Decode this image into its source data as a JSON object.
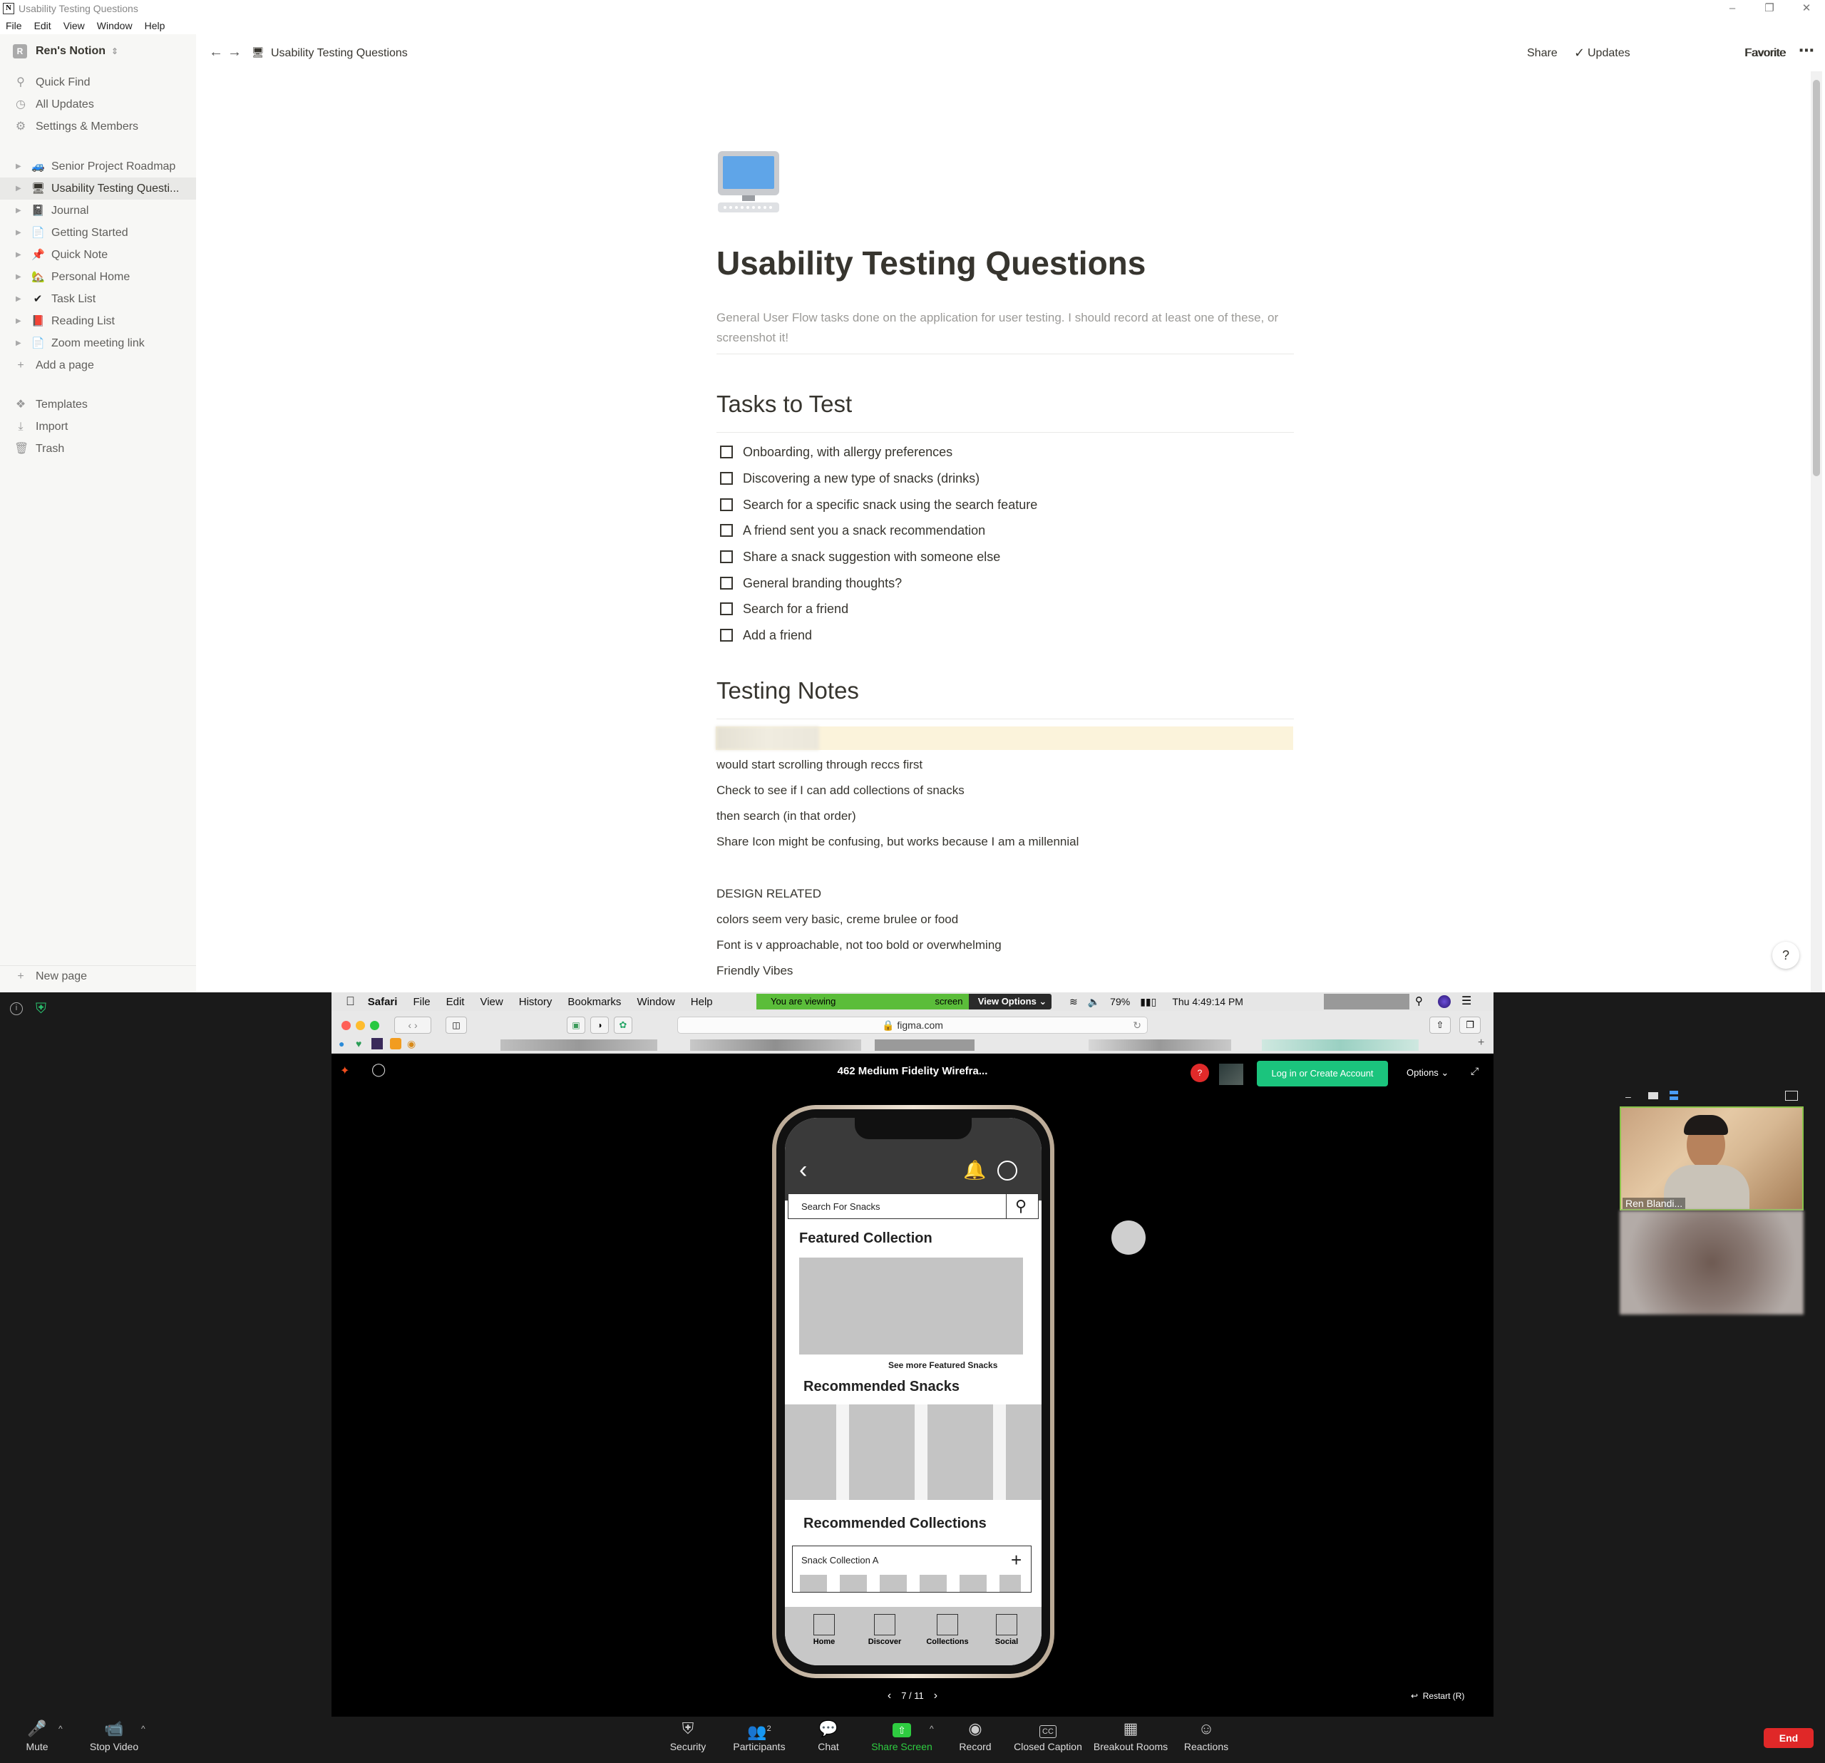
{
  "notion": {
    "window_title": "Usability Testing Questions",
    "menu": [
      "File",
      "Edit",
      "View",
      "Window",
      "Help"
    ],
    "workspace": {
      "initial": "R",
      "name": "Ren's Notion"
    },
    "sidebar_actions": [
      {
        "label": "Quick Find",
        "icon": "search-icon"
      },
      {
        "label": "All Updates",
        "icon": "clock-icon"
      },
      {
        "label": "Settings & Members",
        "icon": "gear-icon"
      }
    ],
    "pages": [
      {
        "label": "Senior Project Roadmap",
        "emoji": "🚙"
      },
      {
        "label": "Usability Testing Questi...",
        "emoji": "🖥"
      },
      {
        "label": "Journal",
        "emoji": "📓"
      },
      {
        "label": "Getting Started",
        "emoji": "📄"
      },
      {
        "label": "Quick Note",
        "emoji": "📌"
      },
      {
        "label": "Personal Home",
        "emoji": "🏡"
      },
      {
        "label": "Task List",
        "emoji": "✔"
      },
      {
        "label": "Reading List",
        "emoji": "📕"
      },
      {
        "label": "Zoom meeting link",
        "emoji": "📄"
      }
    ],
    "add_page": "Add a page",
    "sidebar_bottom": [
      {
        "label": "Templates",
        "icon": "templates-icon"
      },
      {
        "label": "Import",
        "icon": "import-icon"
      },
      {
        "label": "Trash",
        "icon": "trash-icon"
      }
    ],
    "new_page": "New page",
    "breadcrumb": "Usability Testing Questions",
    "topbar": {
      "share": "Share",
      "updates": "Updates",
      "favorite": "Favorite"
    },
    "page": {
      "title": "Usability Testing Questions",
      "description": "General User Flow tasks done on the application for user testing. I should record at least one of these, or screenshot it!",
      "tasks_heading": "Tasks to Test",
      "tasks": [
        "Onboarding, with allergy preferences",
        "Discovering a new type of snacks (drinks)",
        "Search for a specific snack using the search feature",
        "A friend sent you a snack recommendation",
        "Share a snack suggestion with someone else",
        "General branding thoughts?",
        "Search for a friend",
        "Add a friend"
      ],
      "notes_heading": "Testing Notes",
      "notes": [
        "would start scrolling through reccs first",
        "Check to see if I can add collections of snacks",
        "then search (in that order)",
        "Share Icon might be confusing, but works because I am a millennial",
        "",
        "DESIGN RELATED",
        "colors seem very basic, creme brulee or food",
        "Font is v approachable, not too bold or overwhelming",
        "Friendly Vibes"
      ]
    },
    "help": "?"
  },
  "mac": {
    "menu": [
      "Safari",
      "File",
      "Edit",
      "View",
      "History",
      "Bookmarks",
      "Window",
      "Help"
    ],
    "viewing_banner": "You are viewing",
    "screen": "screen",
    "view_options": "View Options",
    "battery": "79%",
    "clock": "Thu 4:49:14 PM",
    "url": "figma.com",
    "figma_title": "462 Medium Fidelity Wirefra...",
    "login": "Log in or Create Account",
    "options": "Options",
    "page_counter": "7 / 11",
    "restart": "Restart (R)"
  },
  "wireframe": {
    "search_placeholder": "Search For Snacks",
    "featured": "Featured Collection",
    "see_more": "See more Featured Snacks",
    "recommended_snacks": "Recommended Snacks",
    "recommended_collections": "Recommended Collections",
    "collection_a": "Snack Collection A",
    "tabs": [
      "Home",
      "Discover",
      "Collections",
      "Social"
    ]
  },
  "zoom": {
    "participant_name": "Ren Blandi...",
    "mute": "Mute",
    "stop_video": "Stop Video",
    "security": "Security",
    "participants": "Participants",
    "participants_count": "2",
    "chat": "Chat",
    "share_screen": "Share Screen",
    "record": "Record",
    "closed_caption": "Closed Caption",
    "breakout": "Breakout Rooms",
    "reactions": "Reactions",
    "end": "End"
  }
}
